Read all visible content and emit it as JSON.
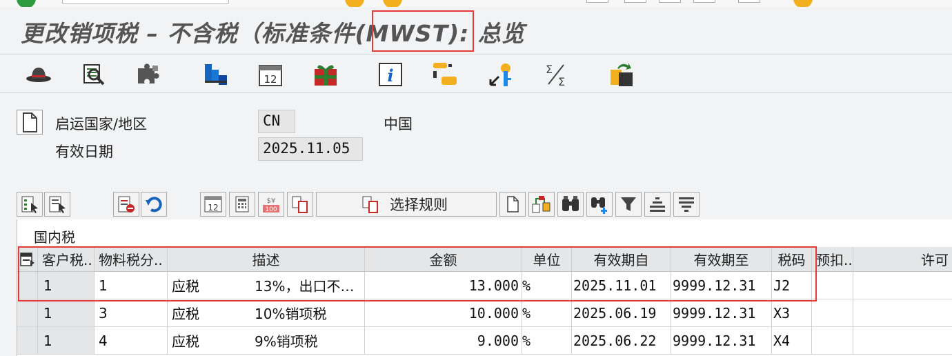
{
  "window": {
    "title": "更改销项税 – 不含税（标准条件(MWST): 总览"
  },
  "header": {
    "country_label": "启运国家/地区",
    "country_code": "CN",
    "country_name": "中国",
    "valid_date_label": "有效日期",
    "valid_date": "2025.11.05"
  },
  "alv_toolbar": {
    "select_rule_label": "选择规则"
  },
  "grid": {
    "title": "国内税",
    "columns": [
      "客户税..",
      "物料税分..",
      "描述",
      "金额",
      "单位",
      "有效期自",
      "有效期至",
      "税码",
      "预扣..",
      "许可"
    ],
    "rows": [
      {
        "c1": "1",
        "c2": "1",
        "desc": "应税",
        "desc2": "13%，出口不…",
        "amount": "13.000",
        "unit": "%",
        "from": "2025.11.01",
        "to": "9999.12.31",
        "code": "J2"
      },
      {
        "c1": "1",
        "c2": "3",
        "desc": "应税",
        "desc2": "10%销项税",
        "amount": "10.000",
        "unit": "%",
        "from": "2025.06.19",
        "to": "9999.12.31",
        "code": "X3"
      },
      {
        "c1": "1",
        "c2": "4",
        "desc": "应税",
        "desc2": "9%销项税",
        "amount": "9.000",
        "unit": "%",
        "from": "2025.06.22",
        "to": "9999.12.31",
        "code": "X4"
      }
    ]
  },
  "icons": {
    "app_toolbar": [
      "hat-icon",
      "search-list-icon",
      "puzzle-icon",
      "hierarchy-icon",
      "calendar-icon",
      "gift-icon",
      "info-icon",
      "condition-icon",
      "key-icon",
      "sum-icon",
      "transport-icon"
    ]
  },
  "colors": {
    "highlight": "#e53935",
    "header_bg": "#e4e6e8"
  }
}
